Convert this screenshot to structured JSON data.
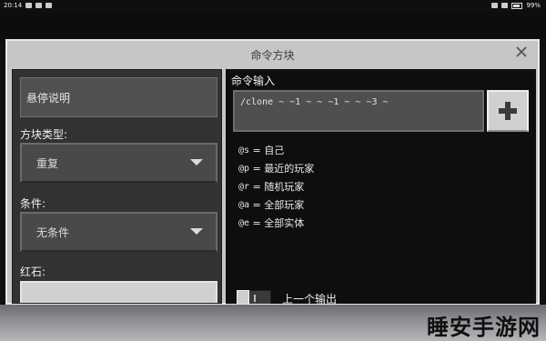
{
  "status_bar": {
    "time": "20:14",
    "battery": "99%"
  },
  "dialog": {
    "title": "命令方块"
  },
  "left_panel": {
    "hover_note": "悬停说明",
    "block_type_label": "方块类型:",
    "block_type_value": "重复",
    "condition_label": "条件:",
    "condition_value": "无条件",
    "redstone_label": "红石:"
  },
  "right_panel": {
    "command_label": "命令输入",
    "command_value": "/clone ~ ~1 ~ ~ ~1 ~ ~ ~3 ~",
    "selectors": [
      {
        "code": "@s",
        "eq": " = ",
        "desc": "自己"
      },
      {
        "code": "@p",
        "eq": " = ",
        "desc": "最近的玩家"
      },
      {
        "code": "@r",
        "eq": " = ",
        "desc": "随机玩家"
      },
      {
        "code": "@a",
        "eq": " = ",
        "desc": "全部玩家"
      },
      {
        "code": "@e",
        "eq": " = ",
        "desc": "全部实体"
      }
    ],
    "previous_output_label": "上一个输出"
  },
  "watermark": "睡安手游网",
  "icons": {
    "close": "close-icon",
    "add": "plus-icon",
    "dropdown": "caret-down-icon"
  }
}
